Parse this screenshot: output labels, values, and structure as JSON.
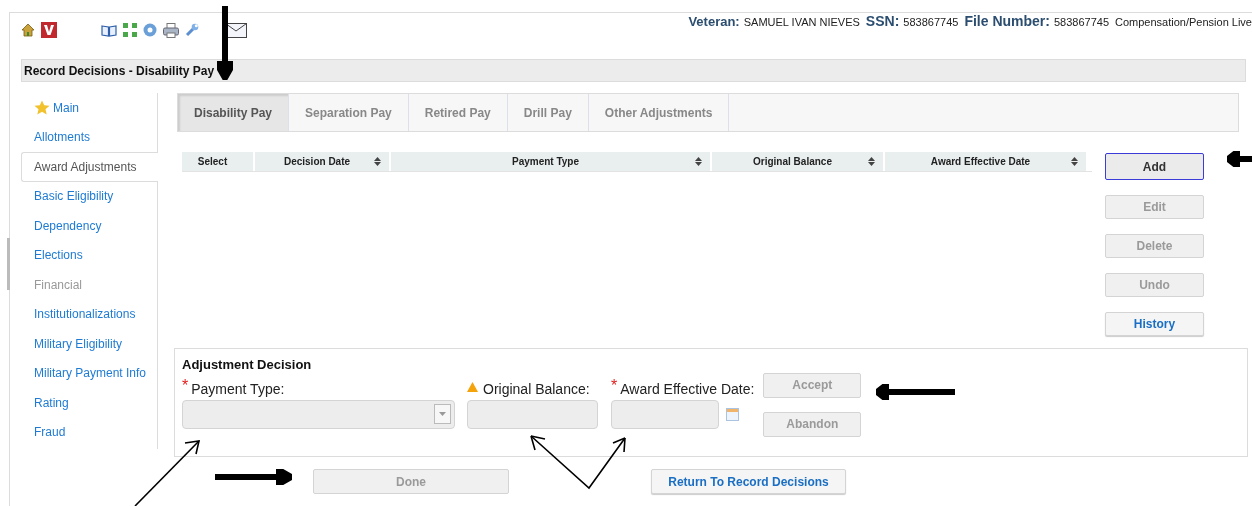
{
  "header": {
    "veteran_label": "Veteran:",
    "veteran": "SAMUEL IVAN NIEVES",
    "ssn_label": "SSN:",
    "ssn": "583867745",
    "file_number_label": "File Number:",
    "file_number": "583867745",
    "program": "Compensation/Pension Live"
  },
  "page_title": "Record Decisions - Disability Pay",
  "sidebar": {
    "items": [
      {
        "label": "Main",
        "kind": "star",
        "selected": false,
        "disabled": false
      },
      {
        "label": "Allotments",
        "kind": "link",
        "selected": false,
        "disabled": false
      },
      {
        "label": "Award Adjustments",
        "kind": "link",
        "selected": true,
        "disabled": false
      },
      {
        "label": "Basic Eligibility",
        "kind": "link",
        "selected": false,
        "disabled": false
      },
      {
        "label": "Dependency",
        "kind": "link",
        "selected": false,
        "disabled": false
      },
      {
        "label": "Elections",
        "kind": "link",
        "selected": false,
        "disabled": false
      },
      {
        "label": "Financial",
        "kind": "link",
        "selected": false,
        "disabled": true
      },
      {
        "label": "Institutionalizations",
        "kind": "link",
        "selected": false,
        "disabled": false
      },
      {
        "label": "Military Eligibility",
        "kind": "link",
        "selected": false,
        "disabled": false
      },
      {
        "label": "Military Payment Info",
        "kind": "link",
        "selected": false,
        "disabled": false
      },
      {
        "label": "Rating",
        "kind": "link",
        "selected": false,
        "disabled": false
      },
      {
        "label": "Fraud",
        "kind": "link",
        "selected": false,
        "disabled": false
      }
    ]
  },
  "tabs": [
    {
      "label": "Disability Pay",
      "selected": true
    },
    {
      "label": "Separation Pay",
      "selected": false
    },
    {
      "label": "Retired Pay",
      "selected": false
    },
    {
      "label": "Drill Pay",
      "selected": false
    },
    {
      "label": "Other Adjustments",
      "selected": false
    }
  ],
  "table": {
    "columns": [
      {
        "label": "Select",
        "sortable": false
      },
      {
        "label": "Decision Date",
        "sortable": true
      },
      {
        "label": "Payment Type",
        "sortable": true
      },
      {
        "label": "Original Balance",
        "sortable": true
      },
      {
        "label": "Award Effective Date",
        "sortable": true
      }
    ]
  },
  "actions": [
    {
      "label": "Add",
      "disabled": false,
      "focused": true
    },
    {
      "label": "Edit",
      "disabled": true,
      "focused": false
    },
    {
      "label": "Delete",
      "disabled": true,
      "focused": false
    },
    {
      "label": "Undo",
      "disabled": true,
      "focused": false
    },
    {
      "label": "History",
      "disabled": false,
      "focused": false
    }
  ],
  "adjustment_decision": {
    "title": "Adjustment Decision",
    "fields": [
      {
        "label": "Payment Type:",
        "required_mark": "*",
        "kind": "select",
        "disabled": true
      },
      {
        "label": "Original Balance:",
        "warning": true,
        "kind": "text",
        "disabled": true
      },
      {
        "label": "Award Effective Date:",
        "required_mark": "*",
        "kind": "date",
        "disabled": true
      }
    ],
    "buttons": [
      {
        "label": "Accept",
        "disabled": true
      },
      {
        "label": "Abandon",
        "disabled": true
      }
    ]
  },
  "footer_buttons": [
    {
      "label": "Done",
      "disabled": true
    },
    {
      "label": "Return To Record Decisions",
      "disabled": false
    }
  ]
}
